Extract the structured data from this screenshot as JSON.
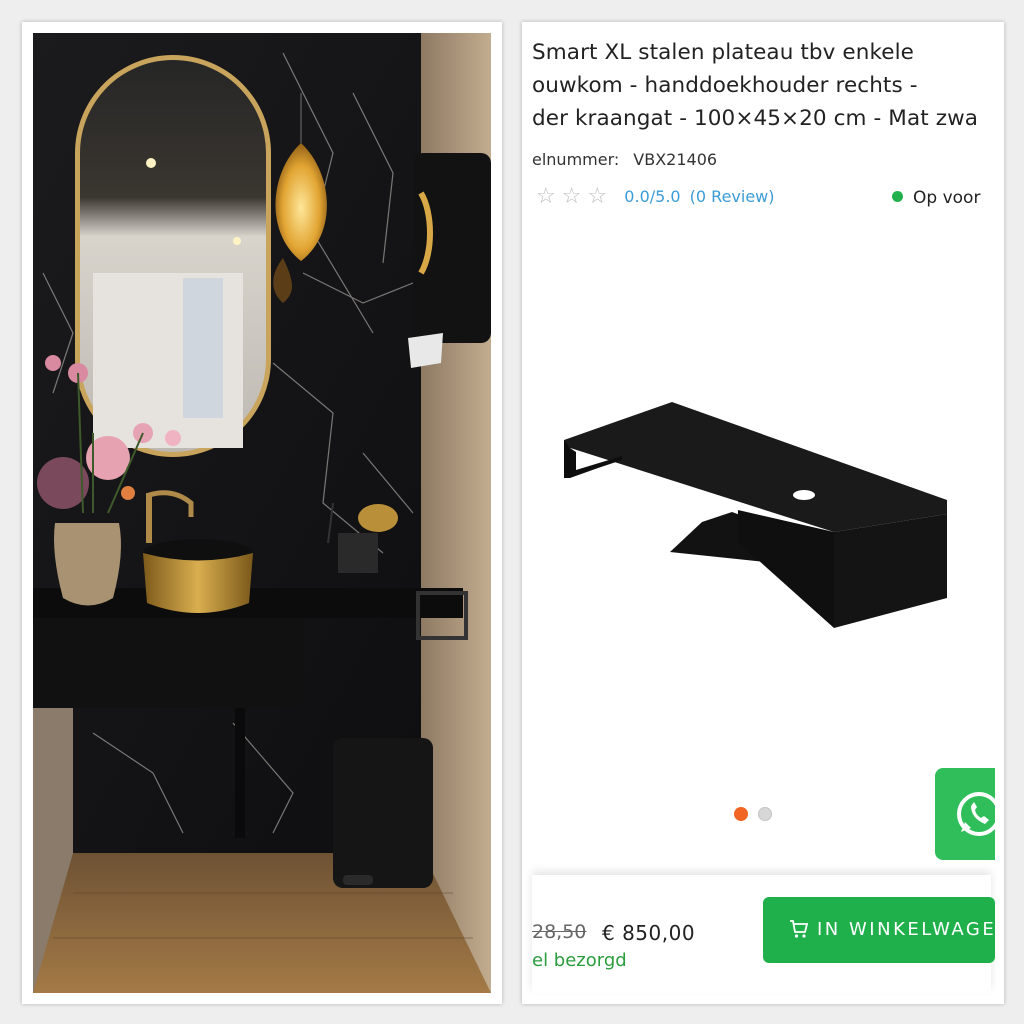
{
  "product": {
    "title_lines": [
      "Smart XL stalen plateau tbv enkele",
      "ouwkom - handdoekhouder rechts -",
      "der kraangat - 100×45×20 cm - Mat zwa"
    ],
    "article_label": "elnummer:",
    "article_number": "VBX21406",
    "rating_score": "0.0/5.0",
    "review_count": "(0 Review)",
    "stock_status": "Op voor"
  },
  "purchase": {
    "old_price": "28,50",
    "price": "€ 850,00",
    "delivery_note": "el bezorgd",
    "add_to_cart_label": "IN WINKELWAGEN"
  },
  "gallery": {
    "active_index": 1,
    "total": 2
  },
  "colors": {
    "accent_green": "#20b04b",
    "link_blue": "#3b9cd6",
    "active_dot": "#f26522"
  },
  "icons": [
    "star-icon",
    "cart-icon",
    "whatsapp-icon",
    "stock-dot"
  ]
}
